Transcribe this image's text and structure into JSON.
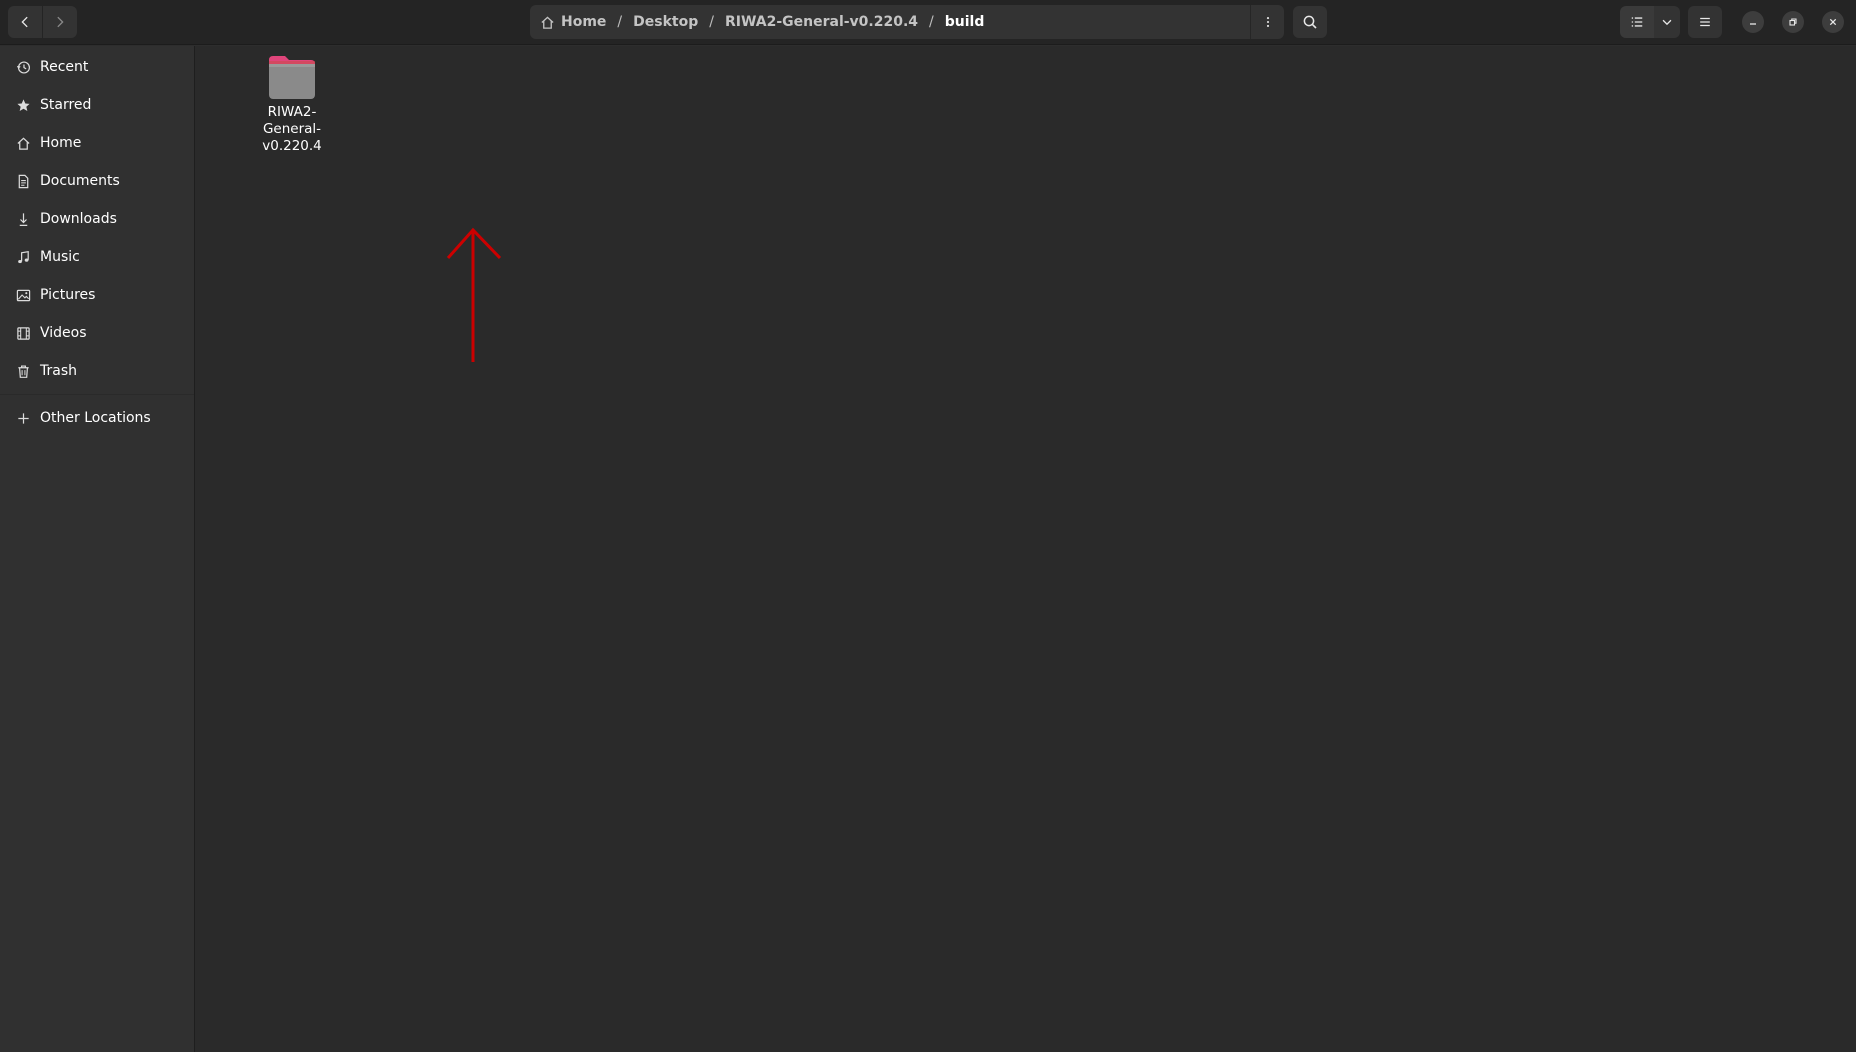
{
  "headerbar": {
    "breadcrumbs": [
      {
        "label": "Home",
        "icon": "home-icon"
      },
      {
        "label": "Desktop"
      },
      {
        "label": "RIWA2-General-v0.220.4"
      },
      {
        "label": "build",
        "current": true
      }
    ],
    "separator": "/"
  },
  "sidebar": {
    "items": [
      {
        "label": "Recent",
        "icon": "clock-icon"
      },
      {
        "label": "Starred",
        "icon": "star-icon"
      },
      {
        "label": "Home",
        "icon": "home-icon"
      },
      {
        "label": "Documents",
        "icon": "document-icon"
      },
      {
        "label": "Downloads",
        "icon": "download-icon"
      },
      {
        "label": "Music",
        "icon": "music-icon"
      },
      {
        "label": "Pictures",
        "icon": "picture-icon"
      },
      {
        "label": "Videos",
        "icon": "film-icon"
      },
      {
        "label": "Trash",
        "icon": "trash-icon"
      }
    ],
    "other_locations": {
      "label": "Other Locations",
      "icon": "plus-icon"
    }
  },
  "content": {
    "files": [
      {
        "name": "RIWA2-General-v0.220.4",
        "type": "folder",
        "icon": "folder-icon"
      }
    ],
    "annotation": {
      "type": "arrow",
      "color": "#cc0000",
      "icon": "red-arrow-up-icon"
    }
  },
  "colors": {
    "headerbar": "#242424",
    "sidebar": "#303030",
    "content": "#2a2a2a",
    "folder_tab": "#e0457b",
    "folder_body": "#8a8a8a"
  }
}
